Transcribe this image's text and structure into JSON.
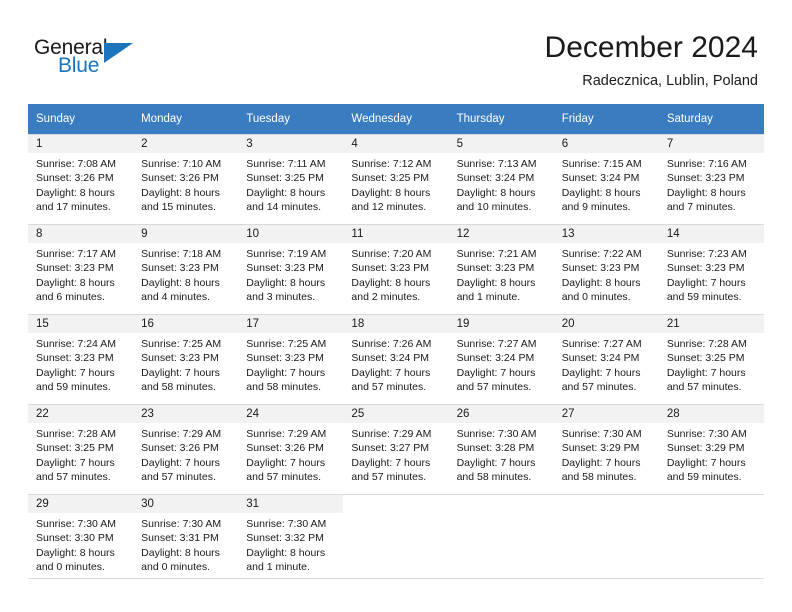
{
  "brand": {
    "name_part1": "General",
    "name_part2": "Blue",
    "accent_color": "#1c74bc"
  },
  "header": {
    "title": "December 2024",
    "location": "Radecznica, Lublin, Poland"
  },
  "calendar": {
    "header_bg": "#3a7cc0",
    "daynum_bg": "#f2f2f2",
    "weekdays": [
      "Sunday",
      "Monday",
      "Tuesday",
      "Wednesday",
      "Thursday",
      "Friday",
      "Saturday"
    ],
    "weeks": [
      [
        {
          "day": "1",
          "sunrise": "Sunrise: 7:08 AM",
          "sunset": "Sunset: 3:26 PM",
          "daylight1": "Daylight: 8 hours",
          "daylight2": "and 17 minutes."
        },
        {
          "day": "2",
          "sunrise": "Sunrise: 7:10 AM",
          "sunset": "Sunset: 3:26 PM",
          "daylight1": "Daylight: 8 hours",
          "daylight2": "and 15 minutes."
        },
        {
          "day": "3",
          "sunrise": "Sunrise: 7:11 AM",
          "sunset": "Sunset: 3:25 PM",
          "daylight1": "Daylight: 8 hours",
          "daylight2": "and 14 minutes."
        },
        {
          "day": "4",
          "sunrise": "Sunrise: 7:12 AM",
          "sunset": "Sunset: 3:25 PM",
          "daylight1": "Daylight: 8 hours",
          "daylight2": "and 12 minutes."
        },
        {
          "day": "5",
          "sunrise": "Sunrise: 7:13 AM",
          "sunset": "Sunset: 3:24 PM",
          "daylight1": "Daylight: 8 hours",
          "daylight2": "and 10 minutes."
        },
        {
          "day": "6",
          "sunrise": "Sunrise: 7:15 AM",
          "sunset": "Sunset: 3:24 PM",
          "daylight1": "Daylight: 8 hours",
          "daylight2": "and 9 minutes."
        },
        {
          "day": "7",
          "sunrise": "Sunrise: 7:16 AM",
          "sunset": "Sunset: 3:23 PM",
          "daylight1": "Daylight: 8 hours",
          "daylight2": "and 7 minutes."
        }
      ],
      [
        {
          "day": "8",
          "sunrise": "Sunrise: 7:17 AM",
          "sunset": "Sunset: 3:23 PM",
          "daylight1": "Daylight: 8 hours",
          "daylight2": "and 6 minutes."
        },
        {
          "day": "9",
          "sunrise": "Sunrise: 7:18 AM",
          "sunset": "Sunset: 3:23 PM",
          "daylight1": "Daylight: 8 hours",
          "daylight2": "and 4 minutes."
        },
        {
          "day": "10",
          "sunrise": "Sunrise: 7:19 AM",
          "sunset": "Sunset: 3:23 PM",
          "daylight1": "Daylight: 8 hours",
          "daylight2": "and 3 minutes."
        },
        {
          "day": "11",
          "sunrise": "Sunrise: 7:20 AM",
          "sunset": "Sunset: 3:23 PM",
          "daylight1": "Daylight: 8 hours",
          "daylight2": "and 2 minutes."
        },
        {
          "day": "12",
          "sunrise": "Sunrise: 7:21 AM",
          "sunset": "Sunset: 3:23 PM",
          "daylight1": "Daylight: 8 hours",
          "daylight2": "and 1 minute."
        },
        {
          "day": "13",
          "sunrise": "Sunrise: 7:22 AM",
          "sunset": "Sunset: 3:23 PM",
          "daylight1": "Daylight: 8 hours",
          "daylight2": "and 0 minutes."
        },
        {
          "day": "14",
          "sunrise": "Sunrise: 7:23 AM",
          "sunset": "Sunset: 3:23 PM",
          "daylight1": "Daylight: 7 hours",
          "daylight2": "and 59 minutes."
        }
      ],
      [
        {
          "day": "15",
          "sunrise": "Sunrise: 7:24 AM",
          "sunset": "Sunset: 3:23 PM",
          "daylight1": "Daylight: 7 hours",
          "daylight2": "and 59 minutes."
        },
        {
          "day": "16",
          "sunrise": "Sunrise: 7:25 AM",
          "sunset": "Sunset: 3:23 PM",
          "daylight1": "Daylight: 7 hours",
          "daylight2": "and 58 minutes."
        },
        {
          "day": "17",
          "sunrise": "Sunrise: 7:25 AM",
          "sunset": "Sunset: 3:23 PM",
          "daylight1": "Daylight: 7 hours",
          "daylight2": "and 58 minutes."
        },
        {
          "day": "18",
          "sunrise": "Sunrise: 7:26 AM",
          "sunset": "Sunset: 3:24 PM",
          "daylight1": "Daylight: 7 hours",
          "daylight2": "and 57 minutes."
        },
        {
          "day": "19",
          "sunrise": "Sunrise: 7:27 AM",
          "sunset": "Sunset: 3:24 PM",
          "daylight1": "Daylight: 7 hours",
          "daylight2": "and 57 minutes."
        },
        {
          "day": "20",
          "sunrise": "Sunrise: 7:27 AM",
          "sunset": "Sunset: 3:24 PM",
          "daylight1": "Daylight: 7 hours",
          "daylight2": "and 57 minutes."
        },
        {
          "day": "21",
          "sunrise": "Sunrise: 7:28 AM",
          "sunset": "Sunset: 3:25 PM",
          "daylight1": "Daylight: 7 hours",
          "daylight2": "and 57 minutes."
        }
      ],
      [
        {
          "day": "22",
          "sunrise": "Sunrise: 7:28 AM",
          "sunset": "Sunset: 3:25 PM",
          "daylight1": "Daylight: 7 hours",
          "daylight2": "and 57 minutes."
        },
        {
          "day": "23",
          "sunrise": "Sunrise: 7:29 AM",
          "sunset": "Sunset: 3:26 PM",
          "daylight1": "Daylight: 7 hours",
          "daylight2": "and 57 minutes."
        },
        {
          "day": "24",
          "sunrise": "Sunrise: 7:29 AM",
          "sunset": "Sunset: 3:26 PM",
          "daylight1": "Daylight: 7 hours",
          "daylight2": "and 57 minutes."
        },
        {
          "day": "25",
          "sunrise": "Sunrise: 7:29 AM",
          "sunset": "Sunset: 3:27 PM",
          "daylight1": "Daylight: 7 hours",
          "daylight2": "and 57 minutes."
        },
        {
          "day": "26",
          "sunrise": "Sunrise: 7:30 AM",
          "sunset": "Sunset: 3:28 PM",
          "daylight1": "Daylight: 7 hours",
          "daylight2": "and 58 minutes."
        },
        {
          "day": "27",
          "sunrise": "Sunrise: 7:30 AM",
          "sunset": "Sunset: 3:29 PM",
          "daylight1": "Daylight: 7 hours",
          "daylight2": "and 58 minutes."
        },
        {
          "day": "28",
          "sunrise": "Sunrise: 7:30 AM",
          "sunset": "Sunset: 3:29 PM",
          "daylight1": "Daylight: 7 hours",
          "daylight2": "and 59 minutes."
        }
      ],
      [
        {
          "day": "29",
          "sunrise": "Sunrise: 7:30 AM",
          "sunset": "Sunset: 3:30 PM",
          "daylight1": "Daylight: 8 hours",
          "daylight2": "and 0 minutes."
        },
        {
          "day": "30",
          "sunrise": "Sunrise: 7:30 AM",
          "sunset": "Sunset: 3:31 PM",
          "daylight1": "Daylight: 8 hours",
          "daylight2": "and 0 minutes."
        },
        {
          "day": "31",
          "sunrise": "Sunrise: 7:30 AM",
          "sunset": "Sunset: 3:32 PM",
          "daylight1": "Daylight: 8 hours",
          "daylight2": "and 1 minute."
        },
        {
          "day": "",
          "sunrise": "",
          "sunset": "",
          "daylight1": "",
          "daylight2": ""
        },
        {
          "day": "",
          "sunrise": "",
          "sunset": "",
          "daylight1": "",
          "daylight2": ""
        },
        {
          "day": "",
          "sunrise": "",
          "sunset": "",
          "daylight1": "",
          "daylight2": ""
        },
        {
          "day": "",
          "sunrise": "",
          "sunset": "",
          "daylight1": "",
          "daylight2": ""
        }
      ]
    ]
  }
}
